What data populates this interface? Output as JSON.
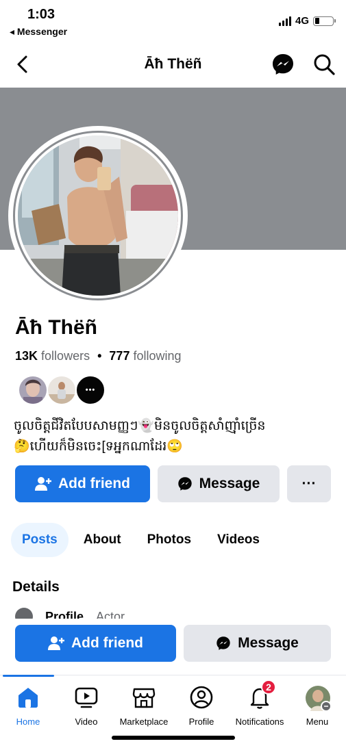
{
  "status_bar": {
    "time": "1:03",
    "back_app": "◂ Messenger",
    "network": "4G",
    "battery_level": 0.25
  },
  "navbar": {
    "title": "Āħ Thëñ"
  },
  "profile": {
    "name": "Āħ Thëñ",
    "followers_count": "13K",
    "followers_label": "followers",
    "separator": "•",
    "following_count": "777",
    "following_label": "following",
    "mutual_more": "•••",
    "bio_line1": "ចូលចិត្តជីវិតបែបសាមញ្ញៗ👻មិនចូលចិត្តសាំញ៉ាំច្រើន",
    "bio_line2": "🤔ហើយក៏មិនចេះ[ទអ្នកណាដែរ🙄"
  },
  "actions": {
    "add_friend": "Add friend",
    "message": "Message",
    "more": "···"
  },
  "tabs": [
    {
      "label": "Posts",
      "active": true
    },
    {
      "label": "About",
      "active": false
    },
    {
      "label": "Photos",
      "active": false
    },
    {
      "label": "Videos",
      "active": false
    }
  ],
  "details": {
    "heading": "Details",
    "peek_label": "Profile",
    "peek_value": "Actor"
  },
  "sticky_actions": {
    "add_friend": "Add friend",
    "message": "Message"
  },
  "tabbar": {
    "items": [
      {
        "label": "Home",
        "icon": "home-icon",
        "active": true
      },
      {
        "label": "Video",
        "icon": "video-icon"
      },
      {
        "label": "Marketplace",
        "icon": "marketplace-icon"
      },
      {
        "label": "Profile",
        "icon": "profile-icon"
      },
      {
        "label": "Notifications",
        "icon": "bell-icon",
        "badge": "2"
      },
      {
        "label": "Menu",
        "icon": "menu-avatar"
      }
    ]
  },
  "colors": {
    "accent": "#1b74e4",
    "cover": "#8a8d91",
    "secondary_button": "#e4e6eb",
    "badge": "#e41e3f"
  }
}
